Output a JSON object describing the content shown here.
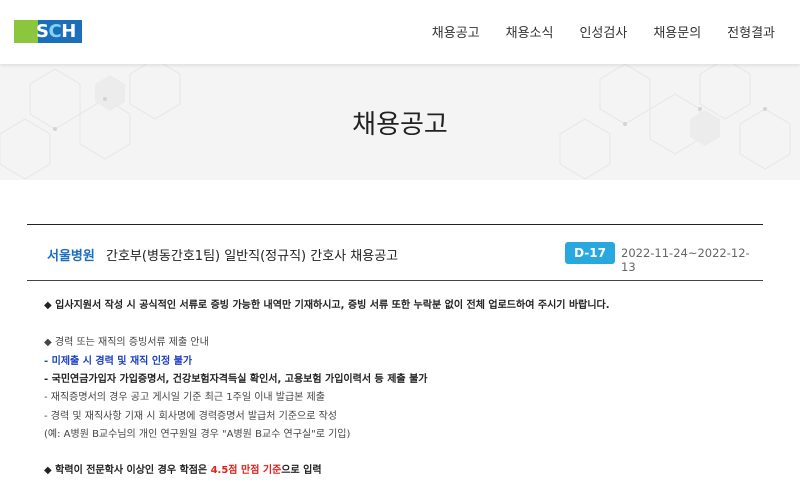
{
  "logo": {
    "text_s": "S",
    "text_c": "C",
    "text_h": "H"
  },
  "nav": [
    "채용공고",
    "채용소식",
    "인성검사",
    "채용문의",
    "전형결과"
  ],
  "hero": {
    "title": "채용공고"
  },
  "post": {
    "hospital": "서울병원",
    "title": "간호부(병동간호1팀) 일반직(정규직) 간호사 채용공고",
    "dday": "D-17",
    "period": "2022-11-24~2022-12-13"
  },
  "notice": {
    "line1": "◆ 입사지원서 작성 시 공식적인 서류로 증빙 가능한 내역만 기재하시고, 증빙 서류 또한 누락분 없이 전체 업로드하여 주시기 바랍니다.",
    "line2": "◆  경력 또는 재직의 증빙서류 제출 안내",
    "line3": "- 미제출 시 경력 및 재직 인정 불가",
    "line4": "- 국민연금가입자 가입증명서, 건강보험자격득실 확인서, 고용보험 가입이력서 등 제출 불가",
    "line5": "- 재직증명서의 경우 공고 게시일 기준 최근 1주일 이내 발급본 제출",
    "line6": "- 경력 및 재직사항 기재 시 회사명에 경력증명서 발급처 기준으로 작성",
    "line7": "  (예: A병원 B교수님의 개인 연구원일 경우 \"A병원 B교수 연구실\"로 기입)",
    "line8_pre": "◆  학력이 전문학사 이상인 경우 학점은 ",
    "line8_red": "4.5점 만점 기준",
    "line8_post": "으로 입력"
  }
}
